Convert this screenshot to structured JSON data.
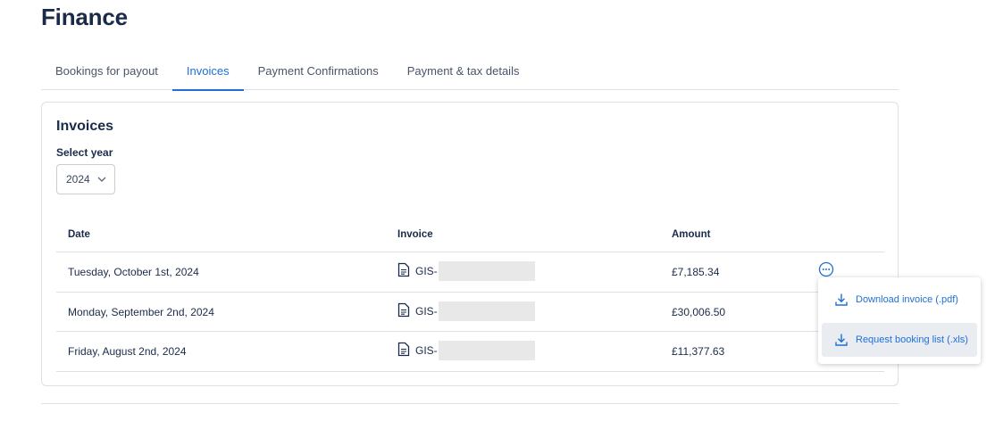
{
  "page": {
    "title": "Finance"
  },
  "tabs": [
    {
      "label": "Bookings for payout",
      "active": false
    },
    {
      "label": "Invoices",
      "active": true
    },
    {
      "label": "Payment Confirmations",
      "active": false
    },
    {
      "label": "Payment & tax details",
      "active": false
    }
  ],
  "invoices": {
    "title": "Invoices",
    "year_label": "Select year",
    "year_value": "2024",
    "columns": {
      "date": "Date",
      "invoice": "Invoice",
      "amount": "Amount"
    },
    "rows": [
      {
        "date": "Tuesday, October 1st, 2024",
        "invoice_prefix": "GIS-",
        "amount": "£7,185.34"
      },
      {
        "date": "Monday, September 2nd, 2024",
        "invoice_prefix": "GIS-",
        "amount": "£30,006.50"
      },
      {
        "date": "Friday, August 2nd, 2024",
        "invoice_prefix": "GIS-",
        "amount": "£11,377.63"
      }
    ]
  },
  "menu": {
    "download_label": "Download invoice (.pdf)",
    "request_label": "Request booking list (.xls)"
  },
  "colors": {
    "accent": "#1f6fd6",
    "text": "#1a2b49",
    "border": "#dcdfe4",
    "redaction": "#e8e8e8",
    "menu_hover": "#e9edf2"
  },
  "icons": [
    "chevron-down-icon",
    "document-icon",
    "more-options-icon",
    "download-icon"
  ]
}
